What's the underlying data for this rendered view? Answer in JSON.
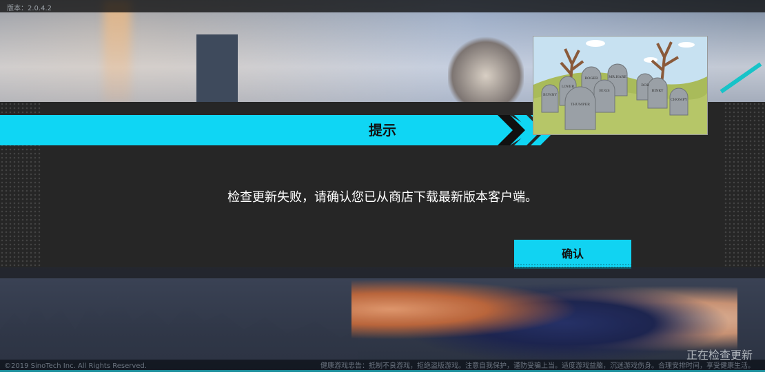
{
  "version_label": "版本：2.0.4.2",
  "dialog": {
    "title": "提示",
    "message": "检查更新失败，请确认您已从商店下载最新版本客户端。",
    "confirm_label": "确认"
  },
  "meme": {
    "tombstones": [
      "THUMPER",
      "BUGS",
      "MR.HARE",
      "ROGER",
      "BINKY",
      "CHOMPY",
      "BUNNY",
      "LOVER"
    ]
  },
  "footer": {
    "copyright": "©2019 SinoTech Inc. All Rights Reserved.",
    "links": "健康游戏忠告：抵制不良游戏，拒绝盗版游戏。注意自我保护，谨防受骗上当。适度游戏益脑，沉迷游戏伤身。合理安排时间，享受健康生活。"
  },
  "status_text": "正在检查更新",
  "colors": {
    "accent": "#0fd6f4",
    "dialog_bg": "#262626"
  }
}
